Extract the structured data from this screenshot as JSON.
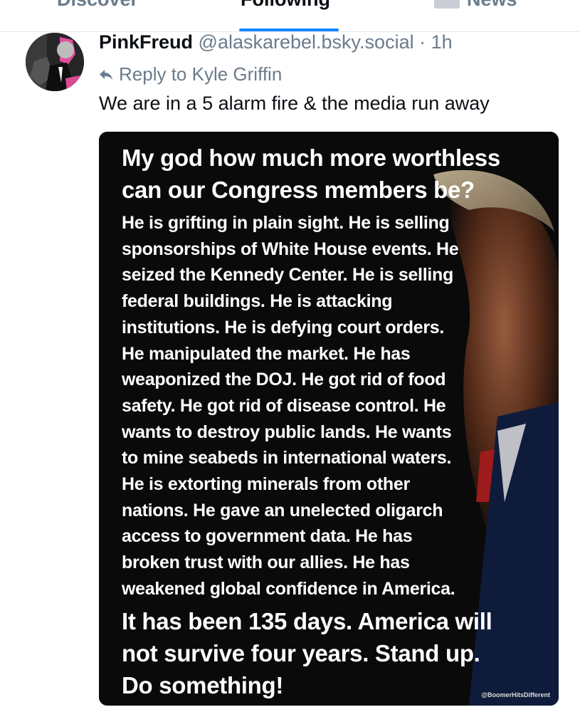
{
  "tabs": [
    {
      "label": "Discover"
    },
    {
      "label": "Following"
    },
    {
      "label": "News"
    }
  ],
  "post": {
    "author": "PinkFreud",
    "handle": "@alaskarebel.bsky.social",
    "separator": "·",
    "time": "1h",
    "reply_to": "Reply to Kyle Griffin",
    "text": "We are in a 5 alarm fire & the media run away"
  },
  "image": {
    "headline_lines": [
      "My god how much more worthless",
      "can our Congress members be?"
    ],
    "body_lines": [
      "He is grifting in plain sight. He is selling",
      "sponsorships of White House events. He",
      "seized the Kennedy Center. He is selling",
      "federal buildings. He is attacking",
      "institutions. He is defying court orders.",
      "He manipulated the market. He has",
      "weaponized the DOJ. He got rid of food",
      "safety. He got rid of disease control. He",
      "wants to destroy public lands. He wants",
      "to mine seabeds in international waters.",
      "He is extorting minerals from other",
      "nations. He gave an unelected oligarch",
      "access to government data. He has",
      "broken trust with our allies. He has",
      "weakened global confidence in America."
    ],
    "closing_lines": [
      "It has been 135 days. America will",
      "not survive four years. Stand up.",
      "Do something!"
    ],
    "watermark": "@BoomerHitsDifferent"
  },
  "icons": {
    "reply": "reply-arrow-icon",
    "news": "newspaper-icon"
  },
  "colors": {
    "accent": "#1083fe",
    "text_primary": "#0b0f14",
    "text_secondary": "#6b7b8c"
  }
}
